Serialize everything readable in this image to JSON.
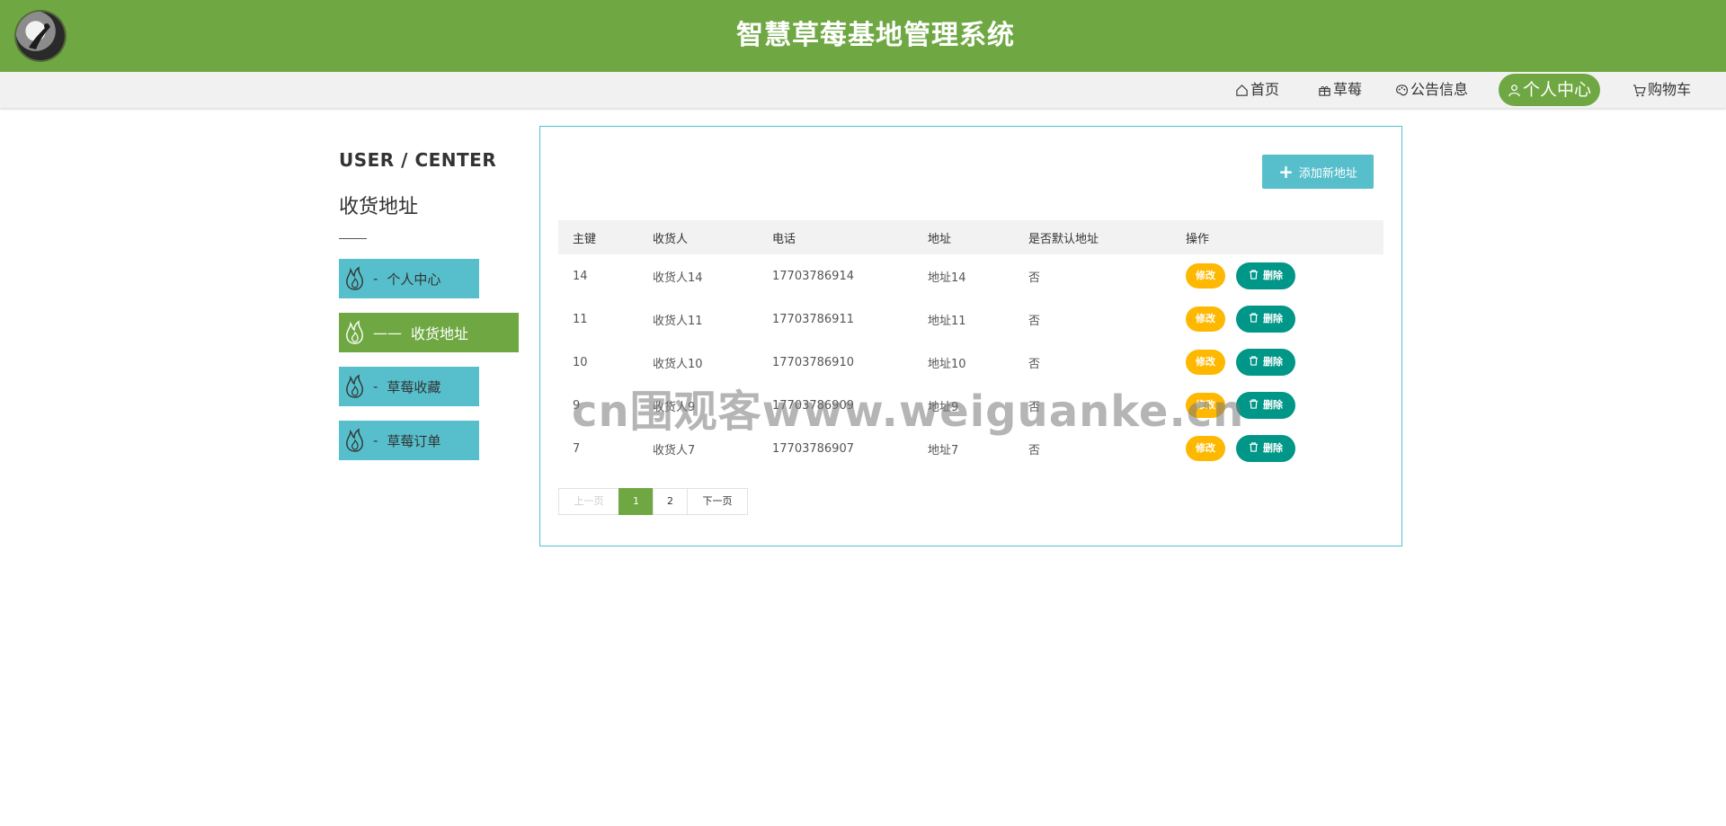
{
  "header": {
    "title": "智慧草莓基地管理系统"
  },
  "nav": {
    "items": [
      {
        "label": "首页",
        "icon": "home-icon"
      },
      {
        "label": "草莓",
        "icon": "gift-icon"
      },
      {
        "label": "公告信息",
        "icon": "palette-icon"
      },
      {
        "label": "个人中心",
        "icon": "user-icon",
        "active": true
      },
      {
        "label": "购物车",
        "icon": "cart-icon"
      }
    ]
  },
  "sidebar": {
    "eng_title": "USER / CENTER",
    "title": "收货地址",
    "items": [
      {
        "label": "个人中心",
        "dash": "-"
      },
      {
        "label": "收货地址",
        "dash": "——",
        "active": true
      },
      {
        "label": "草莓收藏",
        "dash": "-"
      },
      {
        "label": "草莓订单",
        "dash": "-"
      }
    ],
    "icon": "flame-icon"
  },
  "main": {
    "add_button_label": "添加新地址",
    "table": {
      "headers": [
        "主键",
        "收货人",
        "电话",
        "地址",
        "是否默认地址",
        "操作"
      ],
      "rows": [
        {
          "id": "14",
          "name": "收货人14",
          "phone": "17703786914",
          "address": "地址14",
          "default": "否"
        },
        {
          "id": "11",
          "name": "收货人11",
          "phone": "17703786911",
          "address": "地址11",
          "default": "否"
        },
        {
          "id": "10",
          "name": "收货人10",
          "phone": "17703786910",
          "address": "地址10",
          "default": "否"
        },
        {
          "id": "9",
          "name": "收货人9",
          "phone": "17703786909",
          "address": "地址9",
          "default": "否"
        },
        {
          "id": "7",
          "name": "收货人7",
          "phone": "17703786907",
          "address": "地址7",
          "default": "否"
        }
      ],
      "edit_label": "修改",
      "delete_label": "删除"
    },
    "pagination": {
      "prev": "上一页",
      "pages": [
        "1",
        "2"
      ],
      "current": "1",
      "next": "下一页"
    }
  },
  "watermark": "cn围观客www.weiguanke.cn",
  "colors": {
    "brand_green": "#6fa843",
    "teal": "#56bfcb",
    "edit_yellow": "#ffb800",
    "delete_green": "#009688"
  }
}
